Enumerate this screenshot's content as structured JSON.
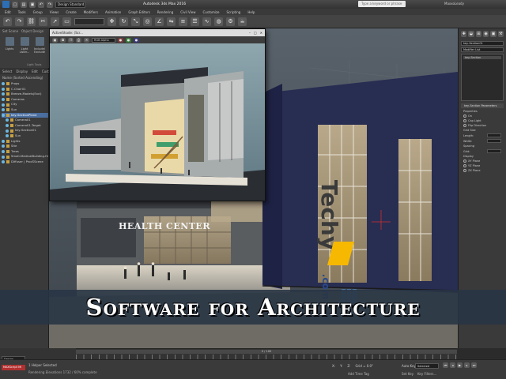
{
  "app": {
    "title": "Autodesk 3ds Max 2016",
    "workspace": "Design Standard",
    "search_placeholder": "Type a keyword or phrase",
    "user": "MaxxoLeady"
  },
  "menu": [
    "Edit",
    "Tools",
    "Group",
    "Views",
    "Create",
    "Modifiers",
    "Animation",
    "Graph Editors",
    "Rendering",
    "Civil View",
    "Customize",
    "Scripting",
    "Help"
  ],
  "toolbar": {
    "icons": [
      "undo-icon",
      "redo-icon",
      "link-icon",
      "unlink-icon",
      "select-icon",
      "select-region-icon",
      "move-icon",
      "rotate-icon",
      "scale-icon",
      "snap-icon",
      "angle-snap-icon",
      "mirror-icon",
      "align-icon",
      "layer-icon",
      "curve-editor-icon",
      "material-editor-icon",
      "render-setup-icon",
      "render-icon"
    ]
  },
  "ribbon": {
    "tabs": [
      "Set Scene",
      "Object Design"
    ],
    "buttons": [
      {
        "label": "Lights",
        "icon": "light-icon"
      },
      {
        "label": "Light Lister...",
        "icon": "light-lister-icon"
      },
      {
        "label": "Include/ Exclude",
        "icon": "include-icon"
      }
    ],
    "caption": "Light Tools"
  },
  "explorer": {
    "tabs": [
      "Select",
      "Display",
      "Edit",
      "Cust"
    ],
    "sort": "Name (Sorted Ascending)",
    "items": [
      {
        "label": "Props",
        "indent": 0,
        "selected": false
      },
      {
        "label": "C.Chair01",
        "indent": 0,
        "selected": false
      },
      {
        "label": "Breeze-Models(Excl)",
        "indent": 0,
        "selected": false
      },
      {
        "label": "Cameras",
        "indent": 0,
        "selected": false
      },
      {
        "label": "City",
        "indent": 0,
        "selected": false
      },
      {
        "label": "Sun",
        "indent": 0,
        "selected": false
      },
      {
        "label": "key-SectionPlane",
        "indent": 0,
        "selected": true
      },
      {
        "label": "Camera01",
        "indent": 1,
        "selected": false
      },
      {
        "label": "Camera01.Target",
        "indent": 1,
        "selected": false
      },
      {
        "label": "key-Section01",
        "indent": 1,
        "selected": false
      },
      {
        "label": "Sun",
        "indent": 1,
        "selected": false
      },
      {
        "label": "Lights",
        "indent": 0,
        "selected": false
      },
      {
        "label": "Site",
        "indent": 0,
        "selected": false
      },
      {
        "label": "Trees",
        "indent": 0,
        "selected": false
      },
      {
        "label": "Small-MedicalBuilding-Hex",
        "indent": 0,
        "selected": false
      },
      {
        "label": "Diffuser | ProcSScene",
        "indent": 0,
        "selected": false
      }
    ]
  },
  "activeshade": {
    "title": "ActiveShade: (Scr...",
    "mode": "RGB Alpha",
    "caption": "HEALTH CENTER"
  },
  "command_panel": {
    "icons": [
      "create-icon",
      "modify-icon",
      "hierarchy-icon",
      "motion-icon",
      "display-icon",
      "utilities-icon"
    ],
    "object_name": "key-Section01",
    "modifier_list": "Modifier List",
    "stack_item": "key-Section",
    "rollout1": "key-Section Parameters",
    "props_label": "Properties",
    "radio_options": [
      "On",
      "Cap Light",
      "Flip Direction"
    ],
    "size_label": "Grid Size",
    "size_fields": [
      "Length:",
      "Width:"
    ],
    "spacing_label": "Spacing",
    "spacing_field": "Grid:",
    "display_label": "Display",
    "display_options": [
      "XY Plane",
      "YZ Plane",
      "ZX Plane"
    ]
  },
  "viewport": {
    "building_sign": "HEALTH CENTER",
    "watermark_text": "Techy",
    "watermark_domain": ".com"
  },
  "banner": "Software for Architecture",
  "timeline": {
    "slider_label": "0 / 100"
  },
  "status": {
    "workspace_dd": "Design Standard",
    "maxscript": "MAXScript Mi",
    "line1": "1 Helper Selected",
    "line2": "Rendering Elevations 1732 / 60% complete",
    "coords": [
      "X:",
      "Y:",
      "Z:",
      "Grid = 0.0\""
    ],
    "autokey": "Auto Key",
    "key_dd": "Selected",
    "add_time_tag": "Add Time Tag",
    "set_key": "Set Key",
    "key_filters": "Key Filters..."
  }
}
